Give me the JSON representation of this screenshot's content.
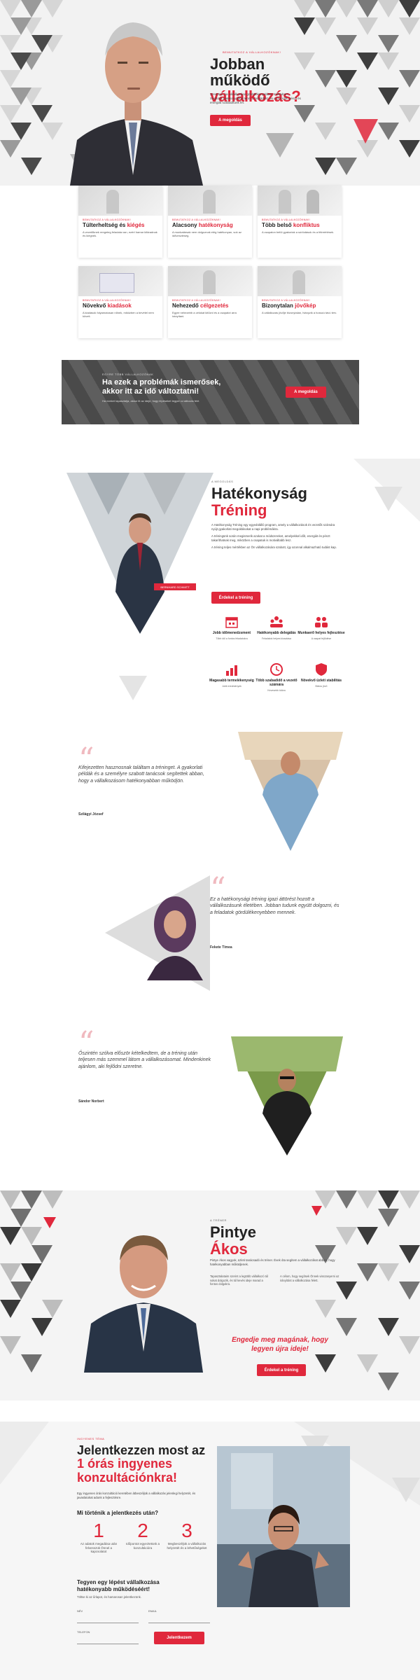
{
  "hero": {
    "kicker": "BEMUTATKOZ A VÁLLALKOZÓKNAK!",
    "title_line1": "Jobban működő",
    "title_line2": "vállalkozás?",
    "description": "Szeretné, ha vállalkozása gördülékenyebben működne? Segítünk hatékonyabbá tenni a működést, és ezzel időt, pénzt és energiát szabadítunk fel.",
    "button": "A megoldás"
  },
  "cards": [
    {
      "kicker": "BEMUTATKOZ A VÁLLALKOZÓKNAK!",
      "title_a": "Túlterheltség",
      "title_sep": " és ",
      "title_b": "kiégés",
      "desc": "A vezetőknek rengeteg feladata van, ezért hamar kifáradnak és kiégnek."
    },
    {
      "kicker": "BEMUTATKOZ A VÁLLALKOZÓKNAK!",
      "title_a": "Alacsony",
      "title_sep": " ",
      "title_b": "hatékonyság",
      "desc": "A munkatársak nem dolgoznak elég hatékonyan, sok az időveszteség."
    },
    {
      "kicker": "BEMUTATKOZ A VÁLLALKOZÓKNAK!",
      "title_a": "Több belső",
      "title_sep": " ",
      "title_b": "konfliktus",
      "desc": "A csapaton belül gyakoriak a súrlódások és a félreértések."
    },
    {
      "kicker": "BEMUTATKOZ A VÁLLALKOZÓKNAK!",
      "title_a": "Növekvő",
      "title_sep": " ",
      "title_b": "kiadások",
      "desc": "A kiadások folyamatosan nőnek, miközben a bevétel nem követi."
    },
    {
      "kicker": "BEMUTATKOZ A VÁLLALKOZÓKNAK!",
      "title_a": "Nehezedő",
      "title_sep": " ",
      "title_b": "célgezetés",
      "desc": "Egyre nehezebb a célokat kitűzni és a csapatot arra irányítani."
    },
    {
      "kicker": "BEMUTATKOZ A VÁLLALKOZÓKNAK!",
      "title_a": "Bizonytalan",
      "title_sep": " ",
      "title_b": "jövőkép",
      "desc": "A vállalkozás jövője bizonytalan, hiányzik a hosszú távú terv."
    }
  ],
  "banner": {
    "kicker": "EGYRE TÖBB VÁLLALKOZÓNAK",
    "title_line1": "Ha ezek a problémák ismerősek,",
    "title_line2": "akkor itt az idő változtatni!",
    "desc": "Ha ezeket tapasztalja, akkor itt az ideje, hogy lépéseket tegyen a változás felé.",
    "button": "A megoldás"
  },
  "training": {
    "kicker": "A MEGOLDÁS",
    "title_a": "Hatékonyság",
    "title_b": "Tréning",
    "badge": "BERNHARD SCHMITT",
    "p1": "A Hatékonyság Tréning egy egyedülálló program, amely a vállalkozások és vezetők számára nyújt gyakorlati megoldásokat a napi problémákra.",
    "p2": "A tréningünk során megismerik azokat a módszereket, amelyekkel időt, energiát és pénzt takaríthatnak meg, miközben a csapatuk is motiváltabb lesz.",
    "p3": "A tréning teljes mértékben az Ön vállalkozására szabott, így azonnal alkalmazható tudást kap.",
    "button": "Érdekel a tréning",
    "features": [
      {
        "title": "Jobb időmenedzsment",
        "desc": "Több idő a fontos feladatokra",
        "icon": "calendar-icon"
      },
      {
        "title": "Hatékonyabb delegálás",
        "desc": "Feladatok helyes kiosztása",
        "icon": "team-icon"
      },
      {
        "title": "Munkaerő helyes fejlesztése",
        "desc": "A csapat fejlődése",
        "icon": "people-icon"
      },
      {
        "title": "Magasabb termelékenység",
        "desc": "Jobb eredmények",
        "icon": "chart-icon"
      },
      {
        "title": "Több szabadidő a vezető számára",
        "desc": "Kevesebb túlóra",
        "icon": "clock-icon"
      },
      {
        "title": "Növekvő üzleti stabilitás",
        "desc": "Biztos jövő",
        "icon": "shield-icon"
      }
    ]
  },
  "testimonials": [
    {
      "text": "Kifejezetten hasznosnak találtam a tréninget. A gyakorlati példák és a személyre szabott tanácsok segítettek abban, hogy a vállalkozásom hatékonyabban működjön.",
      "name": "Szilágyi József"
    },
    {
      "text": "Ez a hatékonysági tréning igazi áttörést hozott a vállalkozásunk életében. Jobban tudunk együtt dolgozni, és a feladatok gördülékenyebben mennek.",
      "name": "Fekete Tímea"
    },
    {
      "text": "Őszintén szólva először kételkedtem, de a tréning után teljesen más szemmel látom a vállalkozásomat. Mindenkinek ajánlom, aki fejlődni szeretne.",
      "name": "Sándor Norbert"
    }
  ],
  "trainer": {
    "kicker": "A TRÉNER",
    "name_a": "Pintye",
    "name_b": "Ákos",
    "intro": "Pintye Ákos vagyok, üzleti tanácsadó és tréner. Évek óta segítem a vállalkozókat abban, hogy hatékonyabban működjenek.",
    "col1": "Tapasztalataim szerint a legtöbb vállalkozó túl sokat dolgozik, és túl kevés ideje marad a fontos dolgokra.",
    "col2": "A célom, hogy segítsek Önnek visszanyerni az irányítást a vállalkozása felett.",
    "slogan_line1": "Engedje meg magának, hogy",
    "slogan_line2": "legyen újra ideje!",
    "button": "Érdekel a tréning"
  },
  "signup": {
    "kicker": "INGYENES TÉMA",
    "title_line1": "Jelentkezzen most az",
    "title_line2": "1 órás ingyenes",
    "title_line3": "konzultációnkra!",
    "desc": "Egy ingyenes órás konzultáció keretében átbeszéljük a vállalkozás jelenlegi helyzetét, és javaslatokat adunk a fejlesztésre.",
    "steps_title": "Mi történik a jelentkezés után?",
    "steps": [
      {
        "num": "1",
        "text": "Az adatok megadása után felvesszük Önnel a kapcsolatot"
      },
      {
        "num": "2",
        "text": "Időpontot egyeztetünk a konzultációra"
      },
      {
        "num": "3",
        "text": "Megbeszéljük a vállalkozás helyzetét és a lehetőségeket"
      }
    ],
    "cta_line1": "Tegyen egy lépést vállalkozása",
    "cta_line2": "hatékonyabb működéséért!",
    "cta_desc": "Töltse ki az űrlapot, és hamarosan jelentkezünk.",
    "field_name": "NÉV",
    "field_email": "EMAIL",
    "field_phone": "TELEFON",
    "submit": "Jelentkezem"
  }
}
